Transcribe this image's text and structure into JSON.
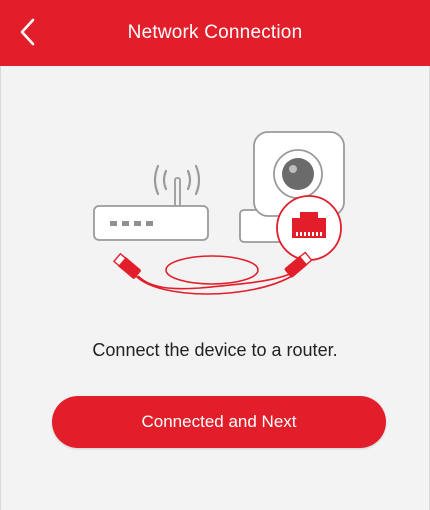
{
  "header": {
    "title": "Network Connection",
    "back_icon": "chevron-left-icon"
  },
  "illustration": {
    "router_icon": "router-icon",
    "camera_icon": "camera-icon",
    "ethernet_port_icon": "ethernet-port-icon",
    "cable_icon": "ethernet-cable-icon",
    "accent_color": "#e21e2b"
  },
  "main": {
    "instruction": "Connect the device to a router.",
    "next_button_label": "Connected and Next"
  },
  "colors": {
    "brand": "#e21e2b",
    "background": "#f3f3f3",
    "text": "#222222"
  }
}
